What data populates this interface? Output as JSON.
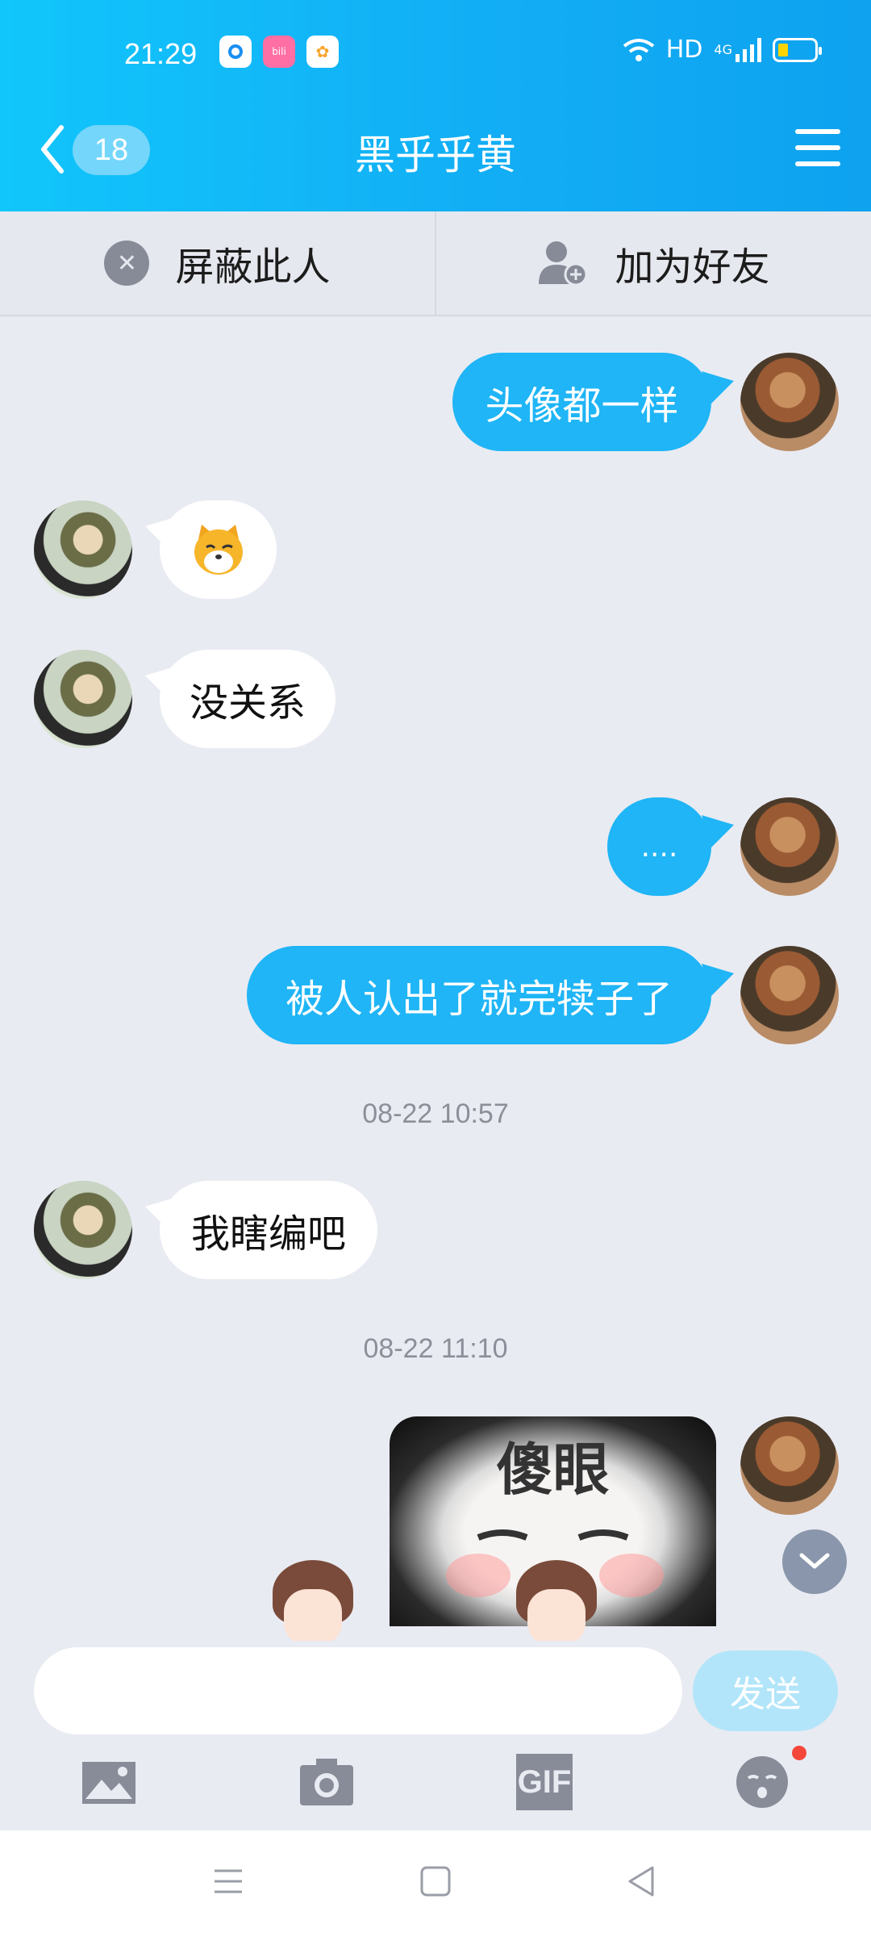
{
  "status_bar": {
    "time": "21:29",
    "network": "HD",
    "signal": "4G"
  },
  "header": {
    "back_count": "18",
    "title": "黑乎乎黄"
  },
  "actions": {
    "block": "屏蔽此人",
    "add_friend": "加为好友"
  },
  "messages": [
    {
      "side": "me",
      "text": "头像都一样"
    },
    {
      "side": "other",
      "text": "",
      "sticker": "dog-emoji"
    },
    {
      "side": "other",
      "text": "没关系"
    },
    {
      "side": "me",
      "text": "...."
    },
    {
      "side": "me",
      "text": "被人认出了就完犊子了"
    },
    {
      "side": "other",
      "text": "我瞎编吧"
    },
    {
      "side": "me",
      "text": "",
      "sticker": "meme-image"
    }
  ],
  "timestamps": [
    "08-22 10:57",
    "08-22 11:10"
  ],
  "sticker_caption": "傻眼",
  "input": {
    "placeholder": "",
    "send_label": "发送"
  },
  "toolbar": [
    "image-icon",
    "camera-icon",
    "gif-icon",
    "emoji-icon"
  ],
  "gif_label": "GIF",
  "colors": {
    "header": "#12aef5",
    "my_bubble": "#1fb5f6",
    "background": "#e9ebf2"
  }
}
